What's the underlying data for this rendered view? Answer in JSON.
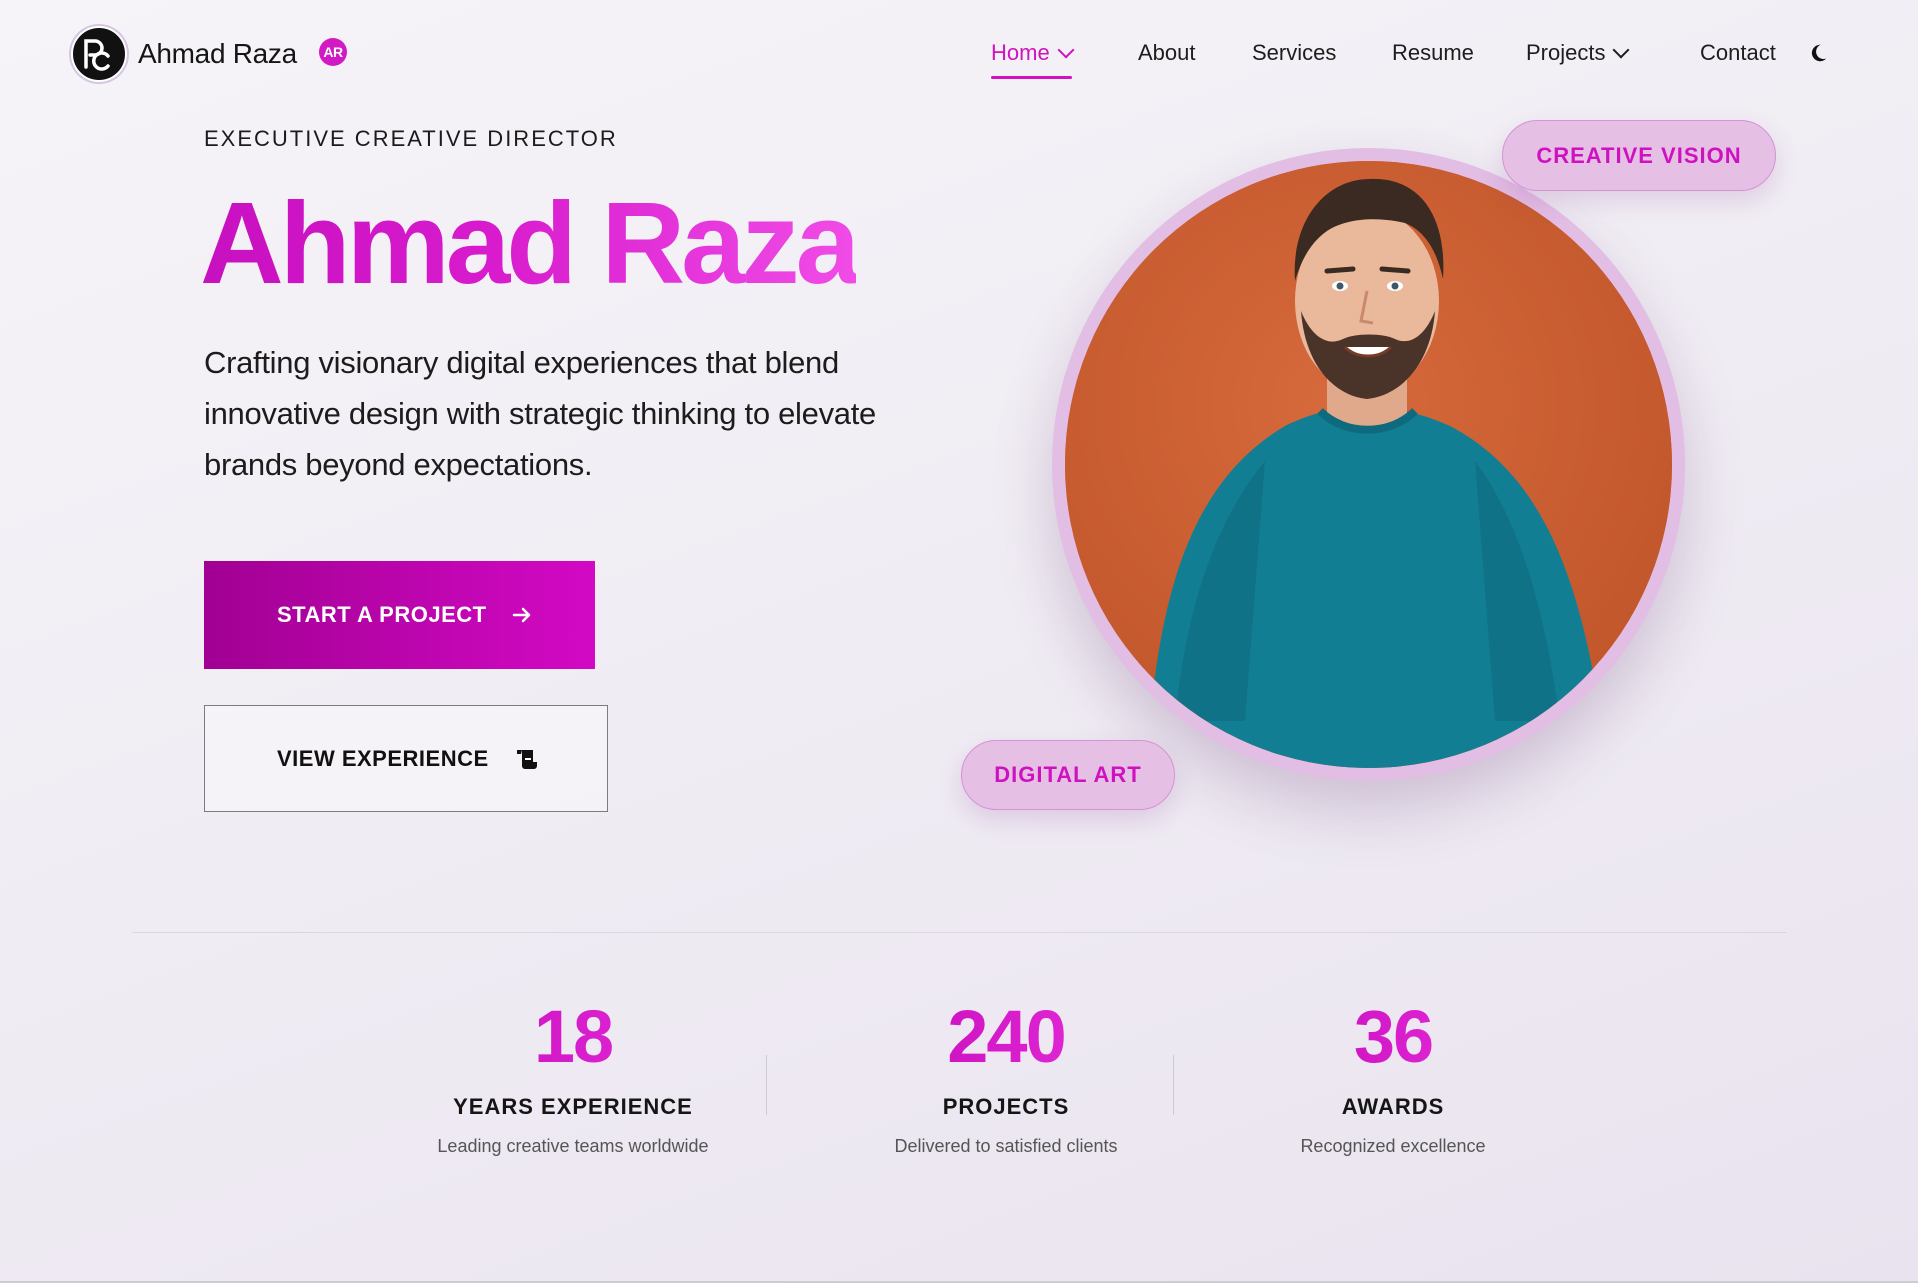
{
  "header": {
    "logo_icon": "pc-monogram-icon",
    "brand_name": "Ahmad Raza",
    "brand_badge": "AR",
    "theme_icon": "moon-icon"
  },
  "nav": {
    "items": [
      {
        "label": "Home",
        "active": true,
        "dropdown": true
      },
      {
        "label": "About",
        "active": false,
        "dropdown": false
      },
      {
        "label": "Services",
        "active": false,
        "dropdown": false
      },
      {
        "label": "Resume",
        "active": false,
        "dropdown": false
      },
      {
        "label": "Projects",
        "active": false,
        "dropdown": true
      },
      {
        "label": "Contact",
        "active": false,
        "dropdown": false
      }
    ]
  },
  "hero": {
    "eyebrow": "EXECUTIVE CREATIVE DIRECTOR",
    "name": "Ahmad Raza",
    "description": "Crafting visionary digital experiences that blend innovative design with strategic thinking to elevate brands beyond expectations.",
    "primary_button": "START A PROJECT",
    "primary_button_icon": "arrow-right-icon",
    "secondary_button": "VIEW EXPERIENCE",
    "secondary_button_icon": "scroll-icon",
    "tags": {
      "top": "CREATIVE VISION",
      "bottom": "DIGITAL ART"
    }
  },
  "stats": [
    {
      "value": "18",
      "label": "YEARS EXPERIENCE",
      "sub": "Leading creative teams worldwide"
    },
    {
      "value": "240",
      "label": "PROJECTS",
      "sub": "Delivered to satisfied clients"
    },
    {
      "value": "36",
      "label": "AWARDS",
      "sub": "Recognized excellence"
    }
  ],
  "colors": {
    "accent": "#d112bf",
    "accent_dark": "#a10093",
    "tag_bg": "#e5bfe4",
    "portrait_bg": "#cd5f32",
    "sweater": "#127e93"
  }
}
